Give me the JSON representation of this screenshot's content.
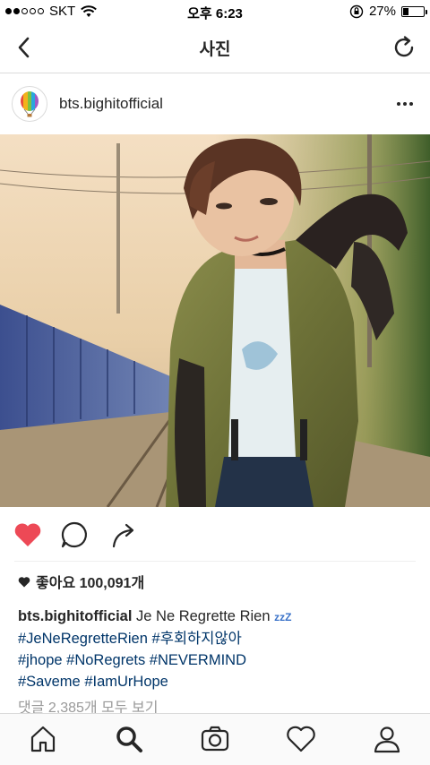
{
  "status_bar": {
    "carrier": "SKT",
    "time": "오후 6:23",
    "battery_percent_text": "27%",
    "battery_level": 0.27,
    "signal_strength": 2
  },
  "nav": {
    "title": "사진",
    "back_icon": "chevron-left-icon",
    "refresh_icon": "refresh-icon"
  },
  "post": {
    "username": "bts.bighitofficial",
    "avatar_icon": "hot-air-balloon-icon",
    "more_icon": "more-horizontal-icon",
    "photo": "photo of a person in an olive bomber jacket beside railway tracks",
    "actions": {
      "like_icon": "heart-filled-icon",
      "comment_icon": "comment-bubble-icon",
      "share_icon": "share-arrow-icon"
    },
    "likes_text": "좋아요 100,091개",
    "caption_user": "bts.bighitofficial",
    "caption_text": "Je Ne Regrette Rien",
    "caption_emoji": "zzZ",
    "hashtags_line1": [
      "#JeNeRegretteRien",
      "#후회하지않아"
    ],
    "hashtags_line2": [
      "#jhope",
      "#NoRegrets",
      "#NEVERMIND"
    ],
    "hashtags_line3": [
      "#Saveme",
      "#IamUrHope"
    ],
    "comments_link": "댓글 2,385개 모두 보기"
  },
  "tab_bar": {
    "items": [
      "home-icon",
      "search-icon",
      "camera-icon",
      "heart-outline-icon",
      "profile-icon"
    ]
  },
  "colors": {
    "like_red": "#ed4956",
    "hashtag_blue": "#003569",
    "muted_grey": "#999999"
  }
}
